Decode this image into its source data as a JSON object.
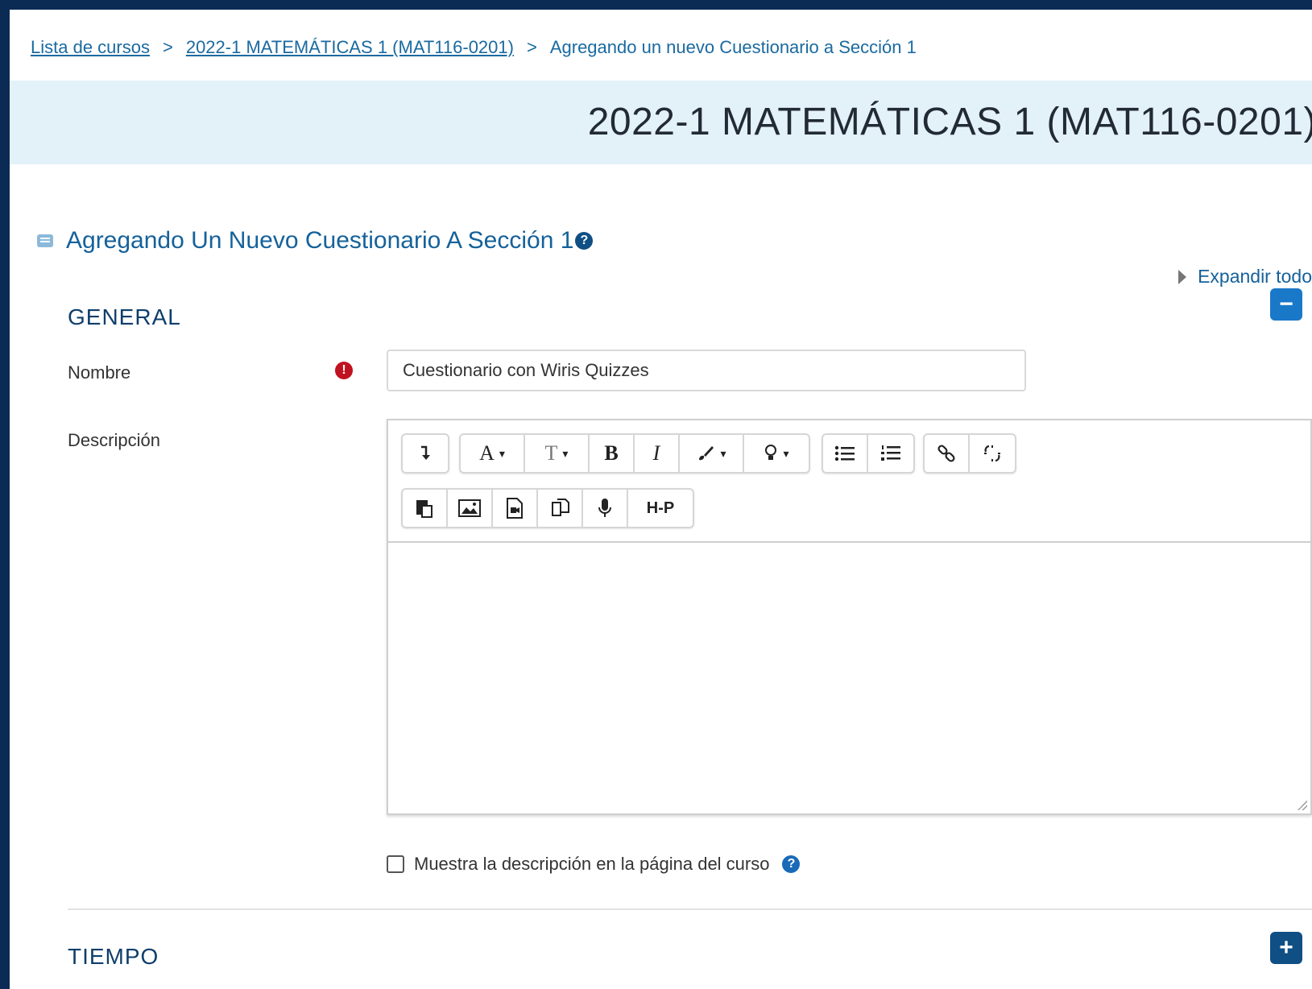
{
  "breadcrumb": {
    "items": [
      "Lista de cursos",
      "2022-1 MATEMÁTICAS 1 (MAT116-0201)",
      "Agregando un nuevo Cuestionario a Sección 1"
    ],
    "separator": ">"
  },
  "course": {
    "title": "2022-1 MATEMÁTICAS 1 (MAT116-0201)"
  },
  "heading": {
    "title": "Agregando Un Nuevo Cuestionario A Sección 1",
    "help_glyph": "?"
  },
  "expand_all": {
    "label": "Expandir todo"
  },
  "sections": {
    "general": {
      "legend": "GENERAL",
      "toggle": "−",
      "state": "expanded"
    },
    "tiempo": {
      "legend": "TIEMPO",
      "toggle": "+",
      "state": "collapsed"
    }
  },
  "form": {
    "nombre": {
      "label": "Nombre",
      "required_glyph": "!",
      "value": "Cuestionario con Wiris Quizzes"
    },
    "descripcion": {
      "label": "Descripción"
    },
    "show_description": {
      "label": "Muestra la descripción en la página del curso",
      "checked": false,
      "help_glyph": "?"
    }
  },
  "toolbar": {
    "bold": "B",
    "italic": "I",
    "font_color": "A",
    "font_size": "T",
    "dropdown_caret": "▾",
    "h5p": "H-P",
    "icons": [
      "collapse-icon",
      "font-color-icon",
      "font-size-icon",
      "bold-icon",
      "italic-icon",
      "brush-icon",
      "lightbulb-icon",
      "unordered-list-icon",
      "ordered-list-icon",
      "link-icon",
      "unlink-icon",
      "paste-icon",
      "image-icon",
      "media-icon",
      "manage-files-icon",
      "record-audio-icon",
      "h5p-icon"
    ]
  },
  "colors": {
    "frame": "#0b2a54",
    "header_band": "#e3f1f9",
    "link": "#1a6aa0",
    "heading": "#15619a",
    "required": "#c1121f",
    "toggle_general": "#1a78c9",
    "toggle_tiempo": "#0f4f84"
  }
}
